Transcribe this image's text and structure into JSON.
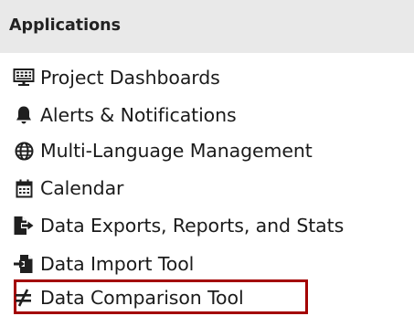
{
  "panel": {
    "title": "Applications"
  },
  "items": [
    {
      "label": "Project Dashboards",
      "icon": "dashboard-monitor-icon"
    },
    {
      "label": "Alerts & Notifications",
      "icon": "bell-icon"
    },
    {
      "label": "Multi-Language Management",
      "icon": "globe-icon"
    },
    {
      "label": "Calendar",
      "icon": "calendar-icon"
    },
    {
      "label": "Data Exports, Reports, and Stats",
      "icon": "file-export-icon"
    },
    {
      "label": "Data Import Tool",
      "icon": "file-import-icon"
    },
    {
      "label": "Data Comparison Tool",
      "icon": "not-equal-icon"
    }
  ],
  "colors": {
    "header_bg": "#e9e9e9",
    "highlight": "#a30000",
    "icon": "#1f1f1f"
  }
}
